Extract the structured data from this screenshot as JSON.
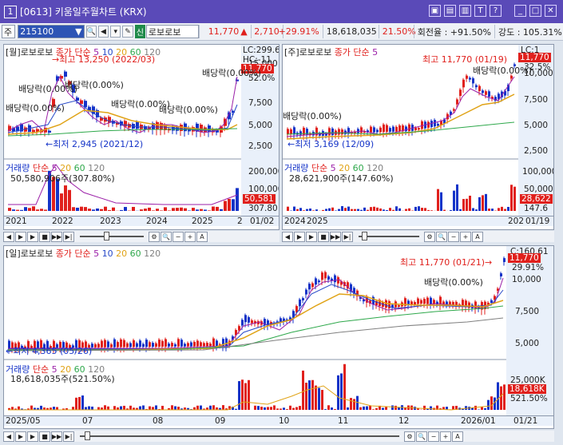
{
  "window": {
    "number": "1",
    "title": "[0613] 키움일주월차트 (KRX)",
    "icons": [
      "layout-icon",
      "image-icon",
      "save-icon",
      "pin-icon",
      "help-icon",
      "minimize-icon",
      "maximize-icon",
      "close-icon"
    ]
  },
  "toolbar": {
    "period": "주",
    "code": "215100",
    "sin_badge": "신",
    "name": "로보로보",
    "price": "11,770",
    "change": "2,710",
    "change_rate": "+29.91%",
    "volume": "18,618,035",
    "vol_ratio": "21.50%",
    "turnover": "회전율 : +91.50%",
    "strength": "강도 : 105.31%"
  },
  "monthly": {
    "title": "[월]로보로보",
    "ma_label": "종가 단순",
    "ma": [
      "5",
      "10",
      "20",
      "60",
      "120"
    ],
    "axis": [
      "15,000",
      "12,500",
      "10,000",
      "7,500",
      "5,000",
      "2,500"
    ],
    "hlc": [
      "LC:299.6",
      "HC:-11"
    ],
    "price_box": "11,770",
    "rate_box": "52.0%",
    "max_note": "최고 13,250 (2022/03)",
    "min_note": "최저 2,945 (2021/12)",
    "div_notes": [
      "배당락(0.00%)",
      "배당락(0.00%)",
      "배당락(0.00%)",
      "배당락(0.00%)",
      "배당락(0.00%)",
      "배당락(0.00%)"
    ],
    "vol_title": "거래량",
    "vol_ma_label": "단순",
    "vol_ma": [
      "5",
      "20",
      "60",
      "120"
    ],
    "vol_value": "50,580,906주(307.80%)",
    "vol_axis": [
      "200,000",
      "100,000"
    ],
    "vol_box": "50,581",
    "vol_box2": "307.80",
    "xlabels": [
      "2021",
      "2022",
      "2023",
      "2024",
      "2025",
      "2"
    ],
    "date": "01/02"
  },
  "weekly": {
    "title": "[주]로보로보",
    "ma_label": "종가 단순",
    "ma": [
      "5"
    ],
    "axis": [
      "12,500",
      "10,000",
      "7,500",
      "5,000",
      "2,500"
    ],
    "hlc": "LC:1",
    "price_box": "11,770",
    "rate_box": "32.5%",
    "max_note": "최고 11,770 (01/19)",
    "min_note": "최저 3,169 (12/09)",
    "div_notes": [
      "배당락(0.00%)",
      "배당락(0.00%)"
    ],
    "vol_title": "거래량",
    "vol_ma_label": "단순",
    "vol_ma": [
      "5",
      "20",
      "60",
      "120"
    ],
    "vol_value": "28,621,900주(147.60%)",
    "vol_axis": [
      "100,000",
      "50,000"
    ],
    "vol_box": "28,622",
    "vol_box2": "147.6",
    "xlabels": [
      "2024",
      "2025",
      "202"
    ],
    "date": "01/19"
  },
  "daily": {
    "title": "[일]로보로보",
    "ma_label": "종가 단순",
    "ma": [
      "5",
      "10",
      "20",
      "60",
      "120"
    ],
    "axis": [
      "10,000",
      "7,500",
      "5,000"
    ],
    "hlc": "C:160.61",
    "price_box": "11,770",
    "rate_box": "29.91%",
    "max_note": "최고 11,770 (01/21)",
    "min_note": "최저 4,365 (05/26)",
    "div_note": "배당락(0.00%)",
    "vol_title": "거래량",
    "vol_ma_label": "단순",
    "vol_ma": [
      "5",
      "20",
      "60",
      "120"
    ],
    "vol_value": "18,618,035주(521.50%)",
    "vol_axis": [
      "25,000K"
    ],
    "vol_box": "18,618K",
    "vol_box2": "521.50%",
    "xlabels": [
      "2025/05",
      "07",
      "08",
      "09",
      "10",
      "11",
      "12",
      "2026/01"
    ],
    "date": "01/21"
  },
  "scroll_icons": [
    "first-icon",
    "prev-icon",
    "play-icon",
    "stop-icon",
    "next-icon",
    "last-icon",
    "settings-icon",
    "zoom-icon",
    "minus-icon",
    "plus-icon",
    "text-size-icon"
  ],
  "colors": {
    "title": "#5a4ab8",
    "up": "#e0201c",
    "down": "#1433c8",
    "ma5": "#9b1fa8",
    "ma10": "#2648c8",
    "ma20": "#e0a317",
    "ma60": "#2ea84b",
    "ma120": "#808080"
  }
}
